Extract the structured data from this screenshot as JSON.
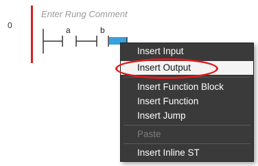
{
  "rung": {
    "number": "0",
    "comment_placeholder": "Enter Rung Comment",
    "contacts": [
      {
        "label": "a"
      },
      {
        "label": "b"
      }
    ]
  },
  "context_menu": {
    "items": [
      {
        "label": "Insert Input",
        "enabled": true
      },
      {
        "label": "Insert Output",
        "enabled": true,
        "highlighted": true
      },
      {
        "label": "Insert Function Block",
        "enabled": true
      },
      {
        "label": "Insert Function",
        "enabled": true
      },
      {
        "label": "Insert Jump",
        "enabled": true
      },
      {
        "label": "Paste",
        "enabled": false
      },
      {
        "label": "Insert Inline ST",
        "enabled": true
      }
    ]
  },
  "colors": {
    "power_rail": "#d32020",
    "selection": "#3aa0dc",
    "menu_background": "#3a3a3a",
    "annotation": "#e01b1b"
  }
}
